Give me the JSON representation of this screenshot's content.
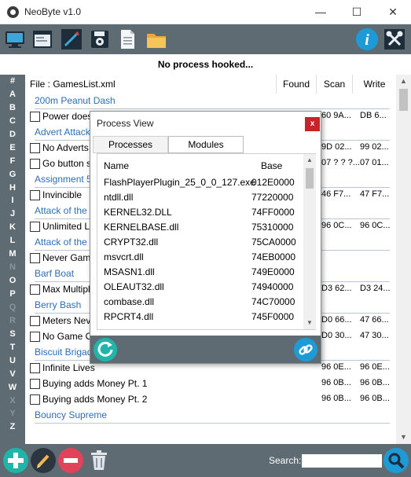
{
  "window": {
    "title": "NeoByte v1.0",
    "minimize_glyph": "—",
    "maximize_glyph": "☐",
    "close_glyph": "✕"
  },
  "toolbar": {
    "left_buttons": [
      "computer-icon",
      "window-icon",
      "pointer-icon",
      "disk-icon",
      "document-icon",
      "folder-icon"
    ],
    "right_buttons": [
      "info-icon",
      "tools-icon"
    ]
  },
  "status": {
    "text": "No process hooked..."
  },
  "sidebar": {
    "letters": [
      "#",
      "A",
      "B",
      "C",
      "D",
      "E",
      "F",
      "G",
      "H",
      "I",
      "J",
      "K",
      "L",
      "M",
      "N",
      "O",
      "P",
      "Q",
      "R",
      "S",
      "T",
      "U",
      "V",
      "W",
      "X",
      "Y",
      "Z"
    ],
    "dim_letters": [
      "N",
      "Q",
      "R",
      "X",
      "Y"
    ]
  },
  "list_header": {
    "file": "File : GamesList.xml",
    "found": "Found",
    "scan": "Scan",
    "write": "Write"
  },
  "games": [
    {
      "title": "200m Peanut Dash",
      "cheats": [
        {
          "name": "Power doesn't decrease",
          "scan": "60 9A...",
          "write": "DB 6..."
        }
      ]
    },
    {
      "title": "Advert Attack",
      "cheats": [
        {
          "name": "No Adverts",
          "scan": "9D 02...",
          "write": "99 02..."
        },
        {
          "name": "Go button sets Money",
          "scan": "07 ? ? ?...",
          "write": "07 01..."
        }
      ]
    },
    {
      "title": "Assignment 5",
      "cheats": [
        {
          "name": "Invincible",
          "scan": "46 F7...",
          "write": "47 F7..."
        }
      ]
    },
    {
      "title": "Attack of the Zombies",
      "cheats": [
        {
          "name": "Unlimited Lives",
          "scan": "96 0C...",
          "write": "96 0C..."
        }
      ]
    },
    {
      "title": "Attack of the Killer Robots",
      "cheats": [
        {
          "name": "Never Game Over",
          "scan": "",
          "write": ""
        }
      ]
    },
    {
      "title": "Barf Boat",
      "cheats": [
        {
          "name": "Max Multiplier",
          "scan": "D3 62...",
          "write": "D3 24..."
        }
      ]
    },
    {
      "title": "Berry Bash",
      "cheats": [
        {
          "name": "Meters Never Empty",
          "scan": "D0 66...",
          "write": "47 66..."
        },
        {
          "name": "No Game Over",
          "scan": "D0 30...",
          "write": "47 30..."
        }
      ]
    },
    {
      "title": "Biscuit Brigade",
      "cheats": [
        {
          "name": "Infinite Lives",
          "scan": "96 0E...",
          "write": "96 0E..."
        },
        {
          "name": "Buying adds Money Pt. 1",
          "scan": "96 0B...",
          "write": "96 0B..."
        },
        {
          "name": "Buying adds Money Pt. 2",
          "scan": "96 0B...",
          "write": "96 0B..."
        }
      ]
    },
    {
      "title": "Bouncy Supreme",
      "cheats": []
    }
  ],
  "bottombar": {
    "search_label": "Search:",
    "search_value": "",
    "buttons": [
      "add-icon",
      "edit-icon",
      "remove-icon",
      "trash-icon"
    ]
  },
  "dialog": {
    "title": "Process View",
    "close_glyph": "x",
    "tabs": [
      "Processes",
      "Modules"
    ],
    "active_tab": "Modules",
    "columns": {
      "name": "Name",
      "base": "Base"
    },
    "modules": [
      {
        "name": "FlashPlayerPlugin_25_0_0_127.exe",
        "base": "012E0000"
      },
      {
        "name": "ntdll.dll",
        "base": "77220000"
      },
      {
        "name": "KERNEL32.DLL",
        "base": "74FF0000"
      },
      {
        "name": "KERNELBASE.dll",
        "base": "75310000"
      },
      {
        "name": "CRYPT32.dll",
        "base": "75CA0000"
      },
      {
        "name": "msvcrt.dll",
        "base": "74EB0000"
      },
      {
        "name": "MSASN1.dll",
        "base": "749E0000"
      },
      {
        "name": "OLEAUT32.dll",
        "base": "74940000"
      },
      {
        "name": "combase.dll",
        "base": "74C70000"
      },
      {
        "name": "RPCRT4.dll",
        "base": "745F0000"
      }
    ],
    "footer_buttons": [
      "refresh-icon",
      "link-icon"
    ]
  },
  "colors": {
    "bar": "#5f6b72",
    "group_title": "#2e6eb3",
    "close_red": "#c8222b",
    "accent_teal": "#20b5a8",
    "info_blue": "#1e9bd7"
  }
}
